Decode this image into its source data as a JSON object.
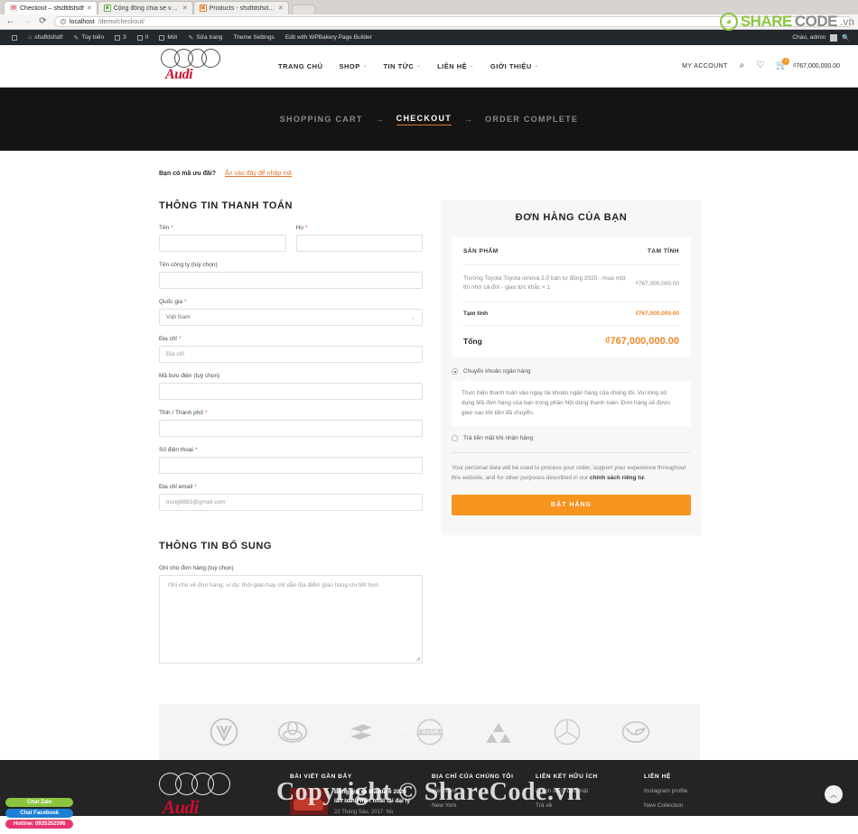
{
  "browser": {
    "tabs": [
      {
        "title": "Checkout – sfsdfdsfsdf",
        "favicon": "checkout-icon",
        "active": true
      },
      {
        "title": "Cộng đồng chia sẻ và do",
        "favicon": "community-icon",
        "active": false
      },
      {
        "title": "Products - sfsdfdsfsdf —",
        "favicon": "products-icon",
        "active": false
      }
    ],
    "close_glyph": "✕",
    "back_glyph": "←",
    "forward_glyph": "→",
    "reload_glyph": "⟳",
    "url_host": "localhost",
    "url_path": "/demo/checkout/",
    "url_icon": "ⓘ"
  },
  "adminbar": {
    "wp_logo": "wordpress-icon",
    "items": [
      {
        "label": "sfsdfdsfsdf",
        "icon": "home-icon"
      },
      {
        "label": "Tùy biến",
        "icon": "pencil-icon"
      },
      {
        "label": "3",
        "icon": "comment-icon"
      },
      {
        "label": "0",
        "icon": "comment-icon"
      },
      {
        "label": "Mới",
        "icon": "plus-icon"
      },
      {
        "label": "Sửa trang",
        "icon": "pencil-icon"
      },
      {
        "label": "Theme Settings",
        "icon": ""
      },
      {
        "label": "Edit with WPBakery Page Builder",
        "icon": ""
      }
    ],
    "greeting": "Chào, admin",
    "search_icon": "search-icon"
  },
  "header": {
    "brand": "Audi",
    "nav": [
      {
        "label": "TRANG CHỦ",
        "has_dropdown": false
      },
      {
        "label": "SHOP",
        "has_dropdown": true
      },
      {
        "label": "TIN TỨC",
        "has_dropdown": true
      },
      {
        "label": "LIÊN HỆ",
        "has_dropdown": true
      },
      {
        "label": "GIỚI THIỆU",
        "has_dropdown": true
      }
    ],
    "my_account": "MY ACCOUNT",
    "search_icon": "search-icon",
    "wishlist_icon": "heart-icon",
    "cart_icon": "cart-icon",
    "cart_count": "1",
    "cart_total": "₫767,000,000.00"
  },
  "steps": {
    "items": [
      {
        "label": "SHOPPING CART",
        "active": false
      },
      {
        "label": "CHECKOUT",
        "active": true
      },
      {
        "label": "ORDER COMPLETE",
        "active": false
      }
    ],
    "arrow": "→"
  },
  "coupon": {
    "question": "Bạn có mã ưu đãi?",
    "link": "Ấn vào đây để nhập mã"
  },
  "billing": {
    "title": "THÔNG TIN THANH TOÁN",
    "first_name": {
      "label": "Tên",
      "required": true,
      "value": "",
      "placeholder": ""
    },
    "last_name": {
      "label": "Họ",
      "required": true,
      "value": "",
      "placeholder": ""
    },
    "company": {
      "label": "Tên công ty (tuỳ chọn)",
      "required": false,
      "value": "",
      "placeholder": ""
    },
    "country": {
      "label": "Quốc gia",
      "required": true,
      "value": "Việt Nam"
    },
    "address": {
      "label": "Địa chỉ",
      "required": true,
      "value": "",
      "placeholder": "Địa chỉ"
    },
    "postcode": {
      "label": "Mã bưu điện (tuỳ chọn)",
      "required": false,
      "value": "",
      "placeholder": ""
    },
    "city": {
      "label": "Tỉnh / Thành phố",
      "required": true,
      "value": "",
      "placeholder": ""
    },
    "phone": {
      "label": "Số điện thoại",
      "required": true,
      "value": "",
      "placeholder": ""
    },
    "email": {
      "label": "Địa chỉ email",
      "required": true,
      "value": "",
      "placeholder": "trong9883@gmail.com"
    },
    "caret_glyph": "⌄"
  },
  "additional": {
    "title": "THÔNG TIN BỔ SUNG",
    "notes_label": "Ghi chú đơn hàng (tuỳ chọn)",
    "notes_placeholder": "Ghi chú về đơn hàng, ví dụ: thời gian hay chỉ dẫn địa điểm giao hàng chi tiết hơn.",
    "notes_value": ""
  },
  "order": {
    "title": "ĐƠN HÀNG CỦA BẠN",
    "col_product": "SẢN PHẨM",
    "col_subtotal": "TẠM TÍNH",
    "items": [
      {
        "name": "Trường Toyota Toyota innova 2.0 bản tự động 2020 - mua một thì nhớ cả đời - giao tức khắc",
        "qty": "× 1",
        "amount": "₫767,000,000.00"
      }
    ],
    "subtotal_label": "Tạm tính",
    "subtotal_value": "₫767,000,000.00",
    "total_label": "Tổng",
    "total_value": "₫767,000,000.00",
    "payments": [
      {
        "label": "Chuyển khoản ngân hàng",
        "selected": true
      },
      {
        "label": "Trả tiền mặt khi nhận hàng",
        "selected": false
      }
    ],
    "payment_description": "Thực hiện thanh toán vào ngay tài khoản ngân hàng của chúng tôi. Vui lòng sử dụng Mã đơn hàng của bạn trong phần Nội dung thanh toán. Đơn hàng sẽ được giao sau khi tiền đã chuyển.",
    "privacy_text": "Your personal data will be used to process your order, support your experience throughout this website, and for other purposes described in our ",
    "privacy_link": "chính sách riêng tư",
    "privacy_tail": ".",
    "place_order_button": "ĐẶT HÀNG",
    "accent_color": "#f7941e"
  },
  "brands": [
    {
      "name": "volkswagen-logo"
    },
    {
      "name": "toyota-logo"
    },
    {
      "name": "suzuki-logo"
    },
    {
      "name": "nissan-logo"
    },
    {
      "name": "mitsubishi-logo"
    },
    {
      "name": "mercedes-logo"
    },
    {
      "name": "mazda-logo"
    }
  ],
  "footer": {
    "brand": "Audi",
    "posts_head": "BÀI VIẾT GẦN ĐÂY",
    "post": {
      "title": "Bảng giá xe Mazda 6 2020 lăn bánh mới nhất tại đại lý",
      "date": "22 Tháng Sáu, 2017",
      "comments": "No"
    },
    "about_head": "ĐỊA CHỈ CỦA CHÚNG TÔI",
    "about_items": [
      "Việt Nam",
      "New York"
    ],
    "links_head": "LIÊN KẾT HỮU ÍCH",
    "links_items": [
      "Chính sách bảo mật",
      "Trả về"
    ],
    "contact_head": "LIÊN HỆ",
    "contact_items": [
      "Instagram profile",
      "New Collection"
    ],
    "scroll_top_icon": "chevron-up-icon"
  },
  "chat": {
    "zalo": "Chat Zalo",
    "facebook": "Chat Facebook",
    "hotline": "Hotline: 0935352596"
  },
  "watermark": {
    "share": "SHARE",
    "code": "CODE",
    "vn": ".vn",
    "center": "ShareCode.vn",
    "copyright": "Copyright © ShareCode.vn"
  }
}
